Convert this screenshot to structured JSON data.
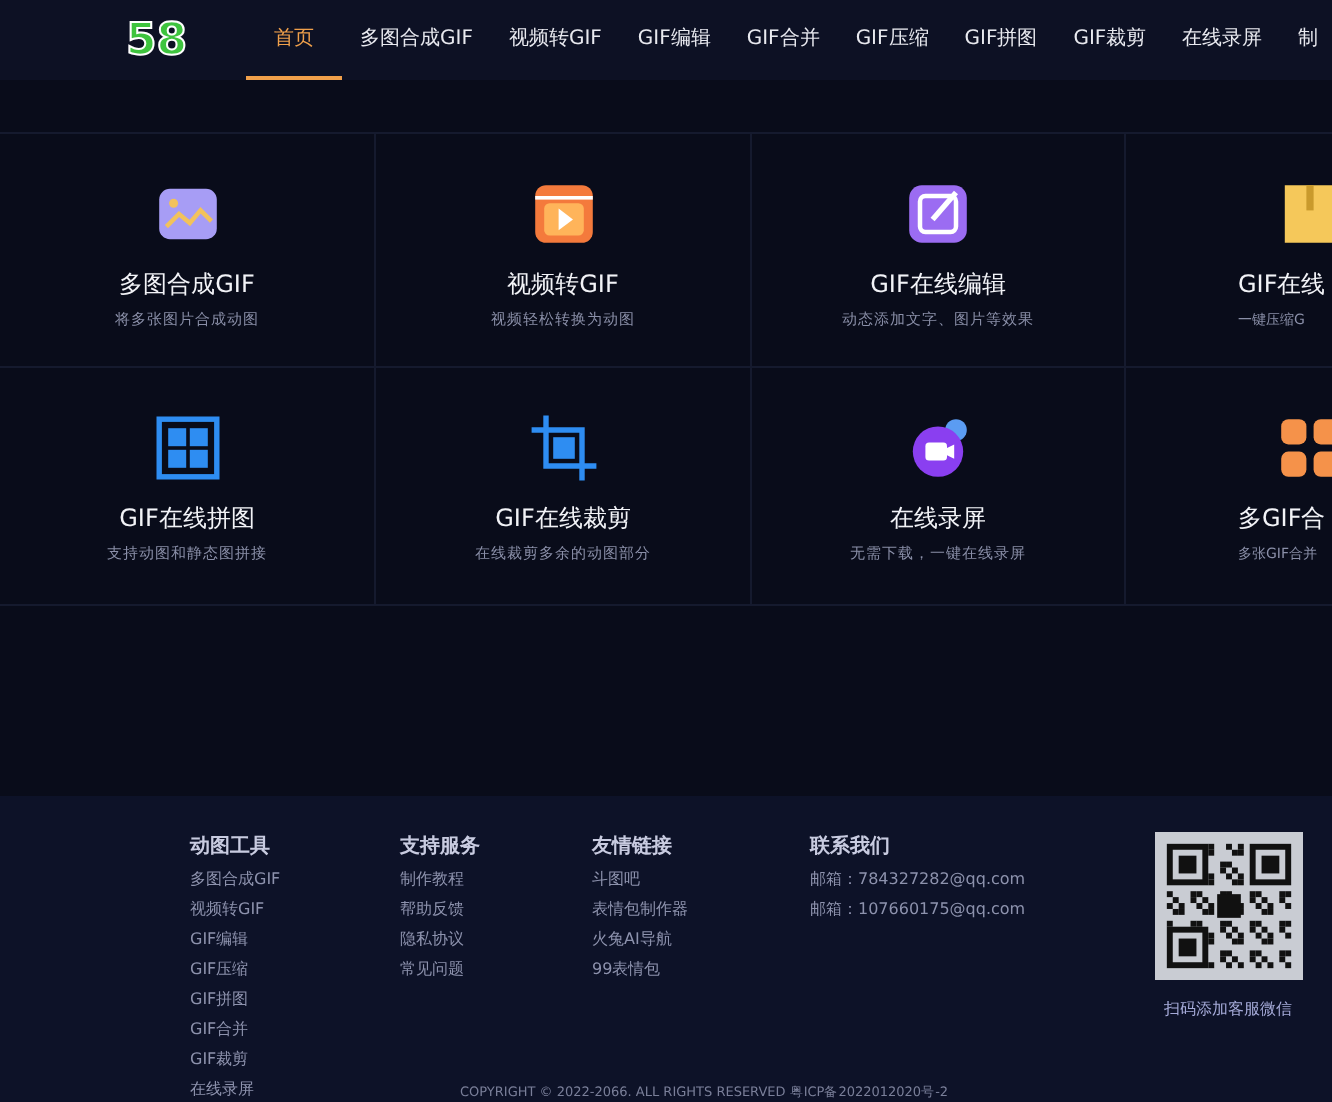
{
  "header": {
    "logo": "58",
    "nav": [
      {
        "label": "首页",
        "selected": true
      },
      {
        "label": "多图合成GIF",
        "selected": false
      },
      {
        "label": "视频转GIF",
        "selected": false
      },
      {
        "label": "GIF编辑",
        "selected": false
      },
      {
        "label": "GIF合并",
        "selected": false
      },
      {
        "label": "GIF压缩",
        "selected": false
      },
      {
        "label": "GIF拼图",
        "selected": false
      },
      {
        "label": "GIF裁剪",
        "selected": false
      },
      {
        "label": "在线录屏",
        "selected": false
      },
      {
        "label": "制",
        "selected": false
      }
    ]
  },
  "tools": [
    {
      "kind": "image",
      "title": "多图合成GIF",
      "desc": "将多张图片合成动图"
    },
    {
      "kind": "video",
      "title": "视频转GIF",
      "desc": "视频轻松转换为动图"
    },
    {
      "kind": "edit",
      "title": "GIF在线编辑",
      "desc": "动态添加文字、图片等效果"
    },
    {
      "kind": "zip",
      "title": "GIF在线",
      "desc": "一键压缩G"
    },
    {
      "kind": "grid",
      "title": "GIF在线拼图",
      "desc": "支持动图和静态图拼接"
    },
    {
      "kind": "crop",
      "title": "GIF在线裁剪",
      "desc": "在线裁剪多余的动图部分"
    },
    {
      "kind": "record",
      "title": "在线录屏",
      "desc": "无需下载，一键在线录屏"
    },
    {
      "kind": "merge",
      "title": "多GIF合",
      "desc": "多张GIF合并"
    }
  ],
  "footer": {
    "columns": [
      {
        "heading": "动图工具",
        "links": [
          "多图合成GIF",
          "视频转GIF",
          "GIF编辑",
          "GIF压缩",
          "GIF拼图",
          "GIF合并",
          "GIF裁剪",
          "在线录屏"
        ]
      },
      {
        "heading": "支持服务",
        "links": [
          "制作教程",
          "帮助反馈",
          "隐私协议",
          "常见问题"
        ]
      },
      {
        "heading": "友情链接",
        "links": [
          "斗图吧",
          "表情包制作器",
          "火兔AI导航",
          "99表情包"
        ]
      },
      {
        "heading": "联系我们",
        "links": [
          "邮箱：784327282@qq.com",
          "邮箱：107660175@qq.com"
        ]
      }
    ],
    "qr_caption": "扫码添加客服微信",
    "copyright": "COPYRIGHT © 2022-2066. ALL RIGHTS RESERVED 粤ICP备2022012020号-2"
  }
}
